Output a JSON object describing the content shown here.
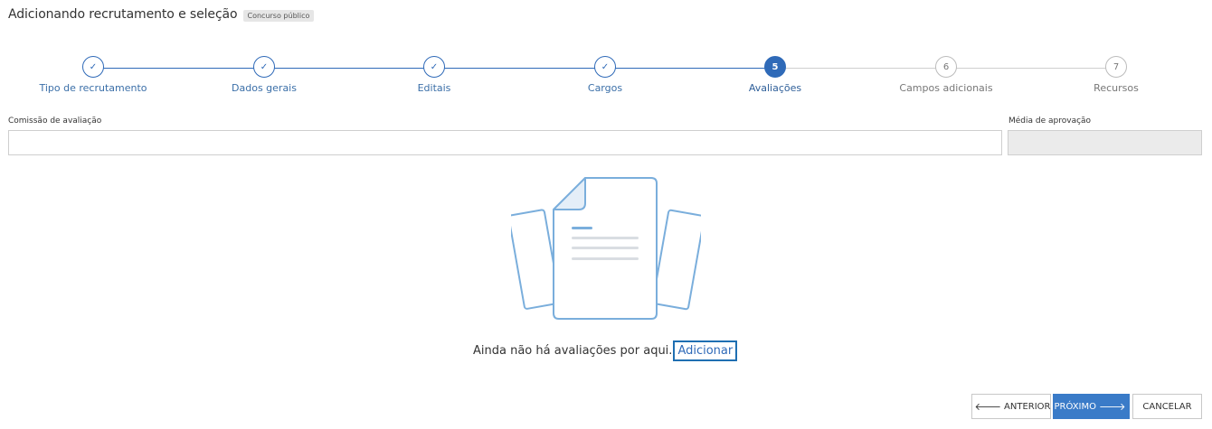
{
  "header": {
    "title": "Adicionando recrutamento e seleção",
    "badge": "Concurso público"
  },
  "stepper": {
    "steps": [
      {
        "label": "Tipo de recrutamento",
        "state": "done",
        "marker": "✓"
      },
      {
        "label": "Dados gerais",
        "state": "done",
        "marker": "✓"
      },
      {
        "label": "Editais",
        "state": "done",
        "marker": "✓"
      },
      {
        "label": "Cargos",
        "state": "done",
        "marker": "✓"
      },
      {
        "label": "Avaliações",
        "state": "active",
        "marker": "5"
      },
      {
        "label": "Campos adicionais",
        "state": "pending",
        "marker": "6"
      },
      {
        "label": "Recursos",
        "state": "pending",
        "marker": "7"
      }
    ]
  },
  "form": {
    "commission_label": "Comissão de avaliação",
    "commission_value": "",
    "approval_label": "Média de aprovação",
    "approval_value": ""
  },
  "empty_state": {
    "message": "Ainda não há avaliações por aqui.",
    "link": "Adicionar",
    "icon": "empty-documents-icon"
  },
  "footer": {
    "prev_label": "ANTERIOR",
    "next_label": "PRÓXIMO",
    "cancel_label": "CANCELAR"
  },
  "colors": {
    "primary": "#2f6ab8",
    "button_primary": "#3a7bc8",
    "illustration_line": "#7aaedc"
  }
}
